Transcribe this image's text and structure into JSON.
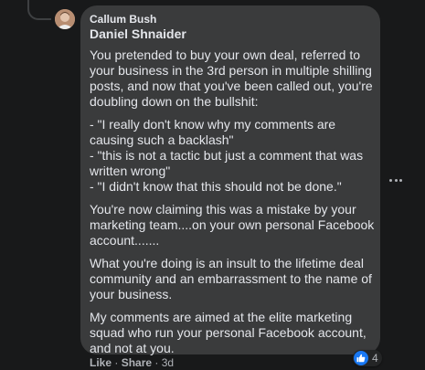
{
  "comment": {
    "author": "Callum Bush",
    "mention": "Daniel Shnaider",
    "paragraphs": [
      [
        "You pretended to buy your own deal, referred to",
        "your business in the 3rd person in multiple shilling",
        "posts, and now that you've been called out, you're",
        "doubling down on the bullshit:"
      ],
      [
        "- \"I really don't know why my comments are",
        "causing such a backlash\"",
        "- \"this is not a tactic but just a comment that was",
        "written wrong\"",
        "- \"I didn't know that this should not be done.\""
      ],
      [
        "You're now claiming this was a mistake by your",
        "marketing team....on your own personal Facebook",
        "account......."
      ],
      [
        "What you're doing is an insult to the lifetime deal",
        "community and an embarrassment to the name of",
        "your business."
      ],
      [
        "My comments are aimed at the elite marketing",
        "squad who run your personal Facebook account,",
        "and not at you."
      ]
    ],
    "reaction_count": "4",
    "actions": {
      "like": "Like",
      "sep1": " · ",
      "share": "Share",
      "sep2": " · ",
      "time": "3d"
    }
  },
  "icons": {
    "reaction": "thumbs-up-icon",
    "more": "more-options-icon",
    "avatar": "user-avatar"
  },
  "colors": {
    "background": "#18191a",
    "bubble": "#3a3b3c",
    "text": "#e4e6eb",
    "secondary_text": "#b0b3b8",
    "like_blue": "#1877f2"
  }
}
